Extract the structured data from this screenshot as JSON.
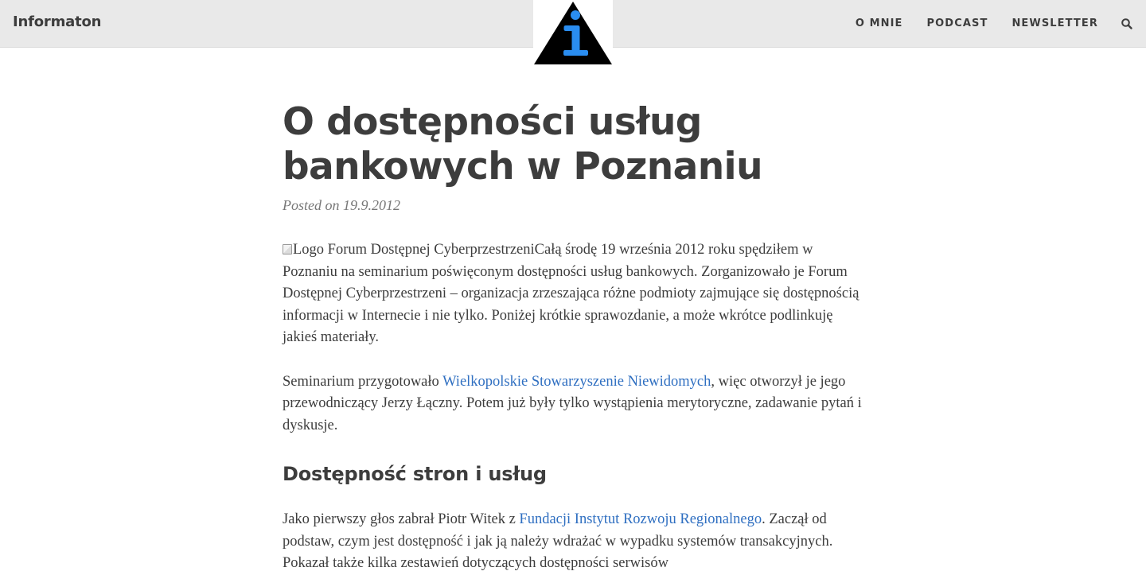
{
  "header": {
    "site_title": "Informaton",
    "logo_icon": "info-triangle-logo",
    "nav": [
      {
        "label": "O MNIE"
      },
      {
        "label": "PODCAST"
      },
      {
        "label": "NEWSLETTER"
      }
    ],
    "search_icon": "search-icon"
  },
  "post": {
    "title": "O dostępności usług bankowych w Poznaniu",
    "meta": "Posted on 19.9.2012",
    "p1": {
      "img_alt": "Logo Forum Dostępnej Cyberprzestrzeni",
      "text": "Całą środę 19 września 2012 roku spędziłem w Poznaniu na seminarium poświęconym dostępności usług bankowych. Zorganizowało je Forum Dostępnej Cyberprzestrzeni – organizacja zrzeszająca różne podmioty zajmujące się dostępnością informacji w Internecie i nie tylko. Poniżej krótkie sprawozdanie, a może wkrótce podlinkuję jakieś materiały."
    },
    "p2": {
      "before": "Seminarium przygotowało ",
      "link": "Wielkopolskie Stowarzyszenie Niewidomych",
      "after": ", więc otworzył je jego przewodniczący Jerzy Łączny. Potem już były tylko wystąpienia merytoryczne, zadawanie pytań i dyskusje."
    },
    "h2": "Dostępność stron i usług",
    "p3": {
      "before": "Jako pierwszy głos zabrał Piotr Witek z ",
      "link": "Fundacji Instytut Rozwoju Regionalnego",
      "after": ". Zaczął od podstaw, czym jest dostępność i jak ją należy wdrażać w wypadku systemów transakcyjnych. Pokazał także kilka zestawień dotyczących dostępności serwisów"
    }
  },
  "colors": {
    "header_bg": "#e9e9e9",
    "text": "#3d3d3d",
    "link": "#2f6fc1",
    "logo_blue": "#2a8df0"
  }
}
